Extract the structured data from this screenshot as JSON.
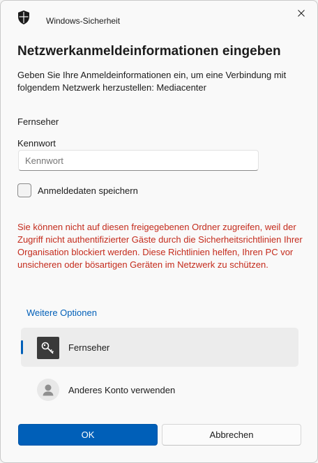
{
  "window": {
    "app_title": "Windows-Sicherheit",
    "close_icon": "close-icon",
    "app_icon": "shield-icon"
  },
  "dialog": {
    "heading": "Netzwerkanmeldeinformationen eingeben",
    "description": "Geben Sie Ihre Anmeldeinformationen ein, um eine Verbindung mit folgendem Netzwerk herzustellen: Mediacenter",
    "username": "Fernseher",
    "password_label": "Kennwort",
    "password_placeholder": "Kennwort",
    "password_value": "",
    "remember_label": "Anmeldedaten speichern",
    "remember_checked": false,
    "error_message": "Sie können nicht auf diesen freigegebenen Ordner zugreifen, weil der Zugriff nicht authentifizierter Gäste durch die Sicherheitsrichtlinien Ihrer Organisation blockiert werden. Diese Richtlinien helfen, Ihren PC vor unsicheren oder bösartigen Geräten im Netzwerk zu schützen.",
    "more_options": "Weitere Optionen"
  },
  "accounts": [
    {
      "label": "Fernseher",
      "icon": "key-icon",
      "selected": true
    },
    {
      "label": "Anderes Konto verwenden",
      "icon": "person-icon",
      "selected": false
    }
  ],
  "buttons": {
    "ok": "OK",
    "cancel": "Abbrechen"
  },
  "colors": {
    "accent": "#005fb8",
    "error": "#c42b1c",
    "background": "#f9f9f9"
  }
}
